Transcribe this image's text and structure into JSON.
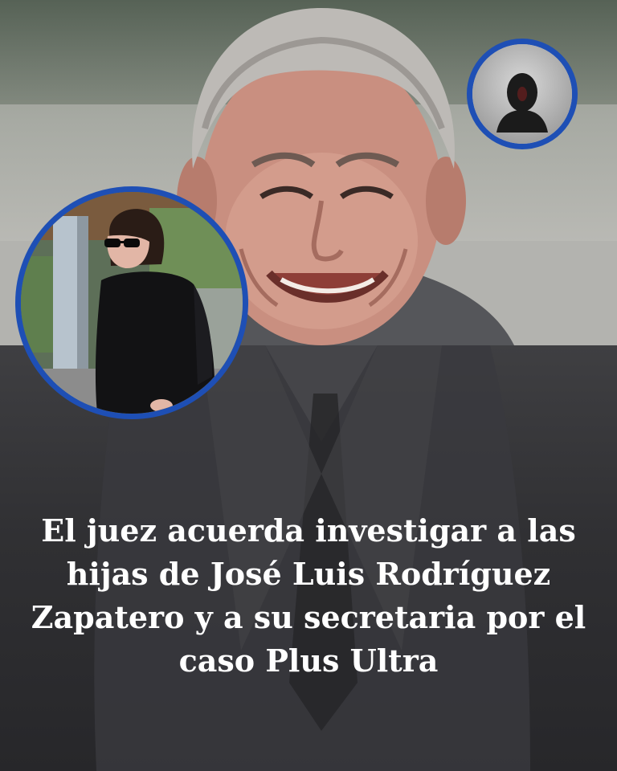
{
  "headline": "El juez acuerda investigar a las hijas de José Luis Rodríguez Zapatero y a su secretaria por el caso Plus Ultra",
  "colors": {
    "circle_border": "#1e4fb5",
    "headline_text": "#ffffff",
    "overlay": "#303033"
  },
  "icons": {
    "small_circle": "person-silhouette-icon"
  }
}
